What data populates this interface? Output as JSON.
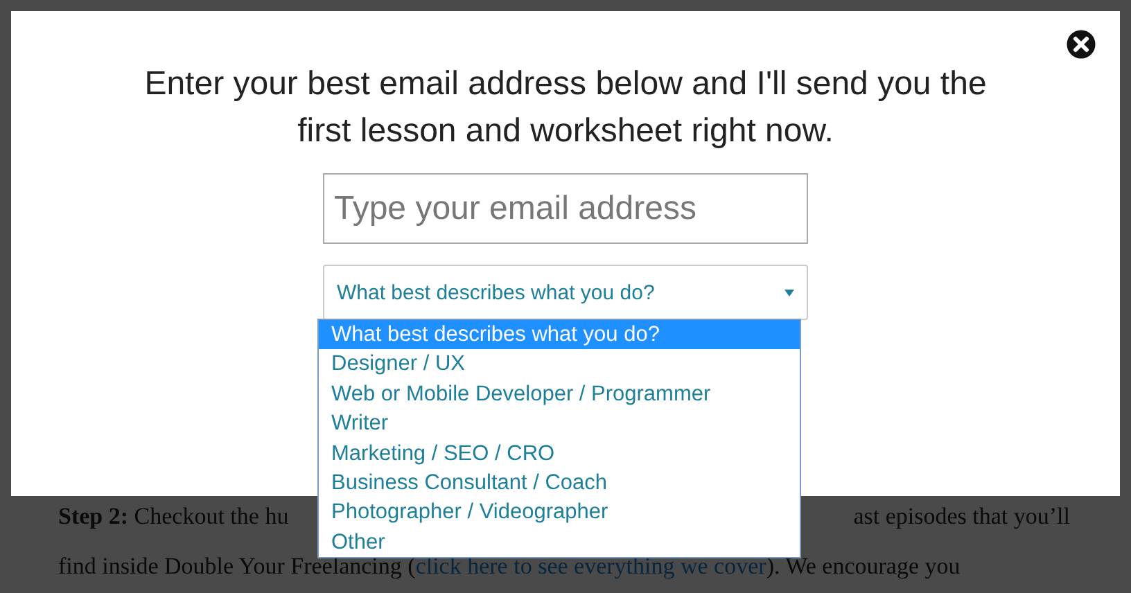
{
  "page": {
    "line_1_start": "**Step 2:** Checkout the hu",
    "line_1_end": "ast episodes that you’ll",
    "line_2": [
      {
        "kind": "text",
        "text": "find inside Double Your Freelancing ("
      },
      {
        "kind": "link",
        "text": "click here to see everything we cover"
      },
      {
        "kind": "text",
        "text": "). We encourage you"
      }
    ]
  },
  "modal": {
    "heading": "Enter your best email address below and I'll send you the first lesson and worksheet right now.",
    "email_field": {
      "placeholder": "Type your email address"
    },
    "select": {
      "value": "What best describes what you do?",
      "expanded": true,
      "options": [
        {
          "label": "What best describes what you do?",
          "selected": true
        },
        {
          "label": "Designer / UX",
          "selected": false
        },
        {
          "label": "Web or Mobile Developer / Programmer",
          "selected": false
        },
        {
          "label": "Writer",
          "selected": false
        },
        {
          "label": "Marketing / SEO / CRO",
          "selected": false
        },
        {
          "label": "Business Consultant / Coach",
          "selected": false
        },
        {
          "label": "Photographer / Videographer",
          "selected": false
        },
        {
          "label": "Other",
          "selected": false
        }
      ]
    }
  }
}
